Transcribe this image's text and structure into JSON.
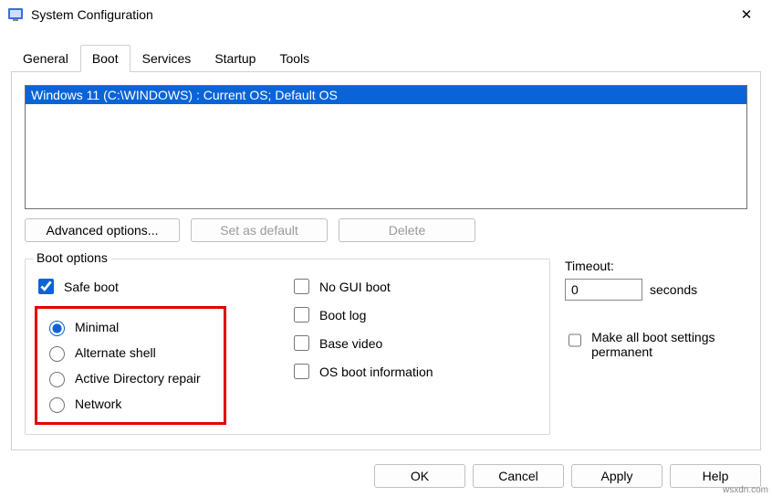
{
  "window": {
    "title": "System Configuration"
  },
  "tabs": {
    "general": "General",
    "boot": "Boot",
    "services": "Services",
    "startup": "Startup",
    "tools": "Tools",
    "active": "boot"
  },
  "oslist": {
    "selected": "Windows 11 (C:\\WINDOWS) : Current OS; Default OS"
  },
  "buttons": {
    "advanced": "Advanced options...",
    "setdefault": "Set as default",
    "delete": "Delete"
  },
  "boot_options": {
    "legend": "Boot options",
    "safe_boot": {
      "label": "Safe boot",
      "checked": true
    },
    "radios": {
      "minimal": "Minimal",
      "altshell": "Alternate shell",
      "adrepair": "Active Directory repair",
      "network": "Network",
      "selected": "minimal"
    },
    "right": {
      "nogui": {
        "label": "No GUI boot",
        "checked": false
      },
      "bootlog": {
        "label": "Boot log",
        "checked": false
      },
      "basevideo": {
        "label": "Base video",
        "checked": false
      },
      "osinfo": {
        "label": "OS boot information",
        "checked": false
      }
    }
  },
  "timeout": {
    "label": "Timeout:",
    "value": "0",
    "unit": "seconds",
    "permanent": {
      "label": "Make all boot settings permanent",
      "checked": false
    }
  },
  "footer": {
    "ok": "OK",
    "cancel": "Cancel",
    "apply": "Apply",
    "help": "Help"
  },
  "watermark": "wsxdn.com"
}
